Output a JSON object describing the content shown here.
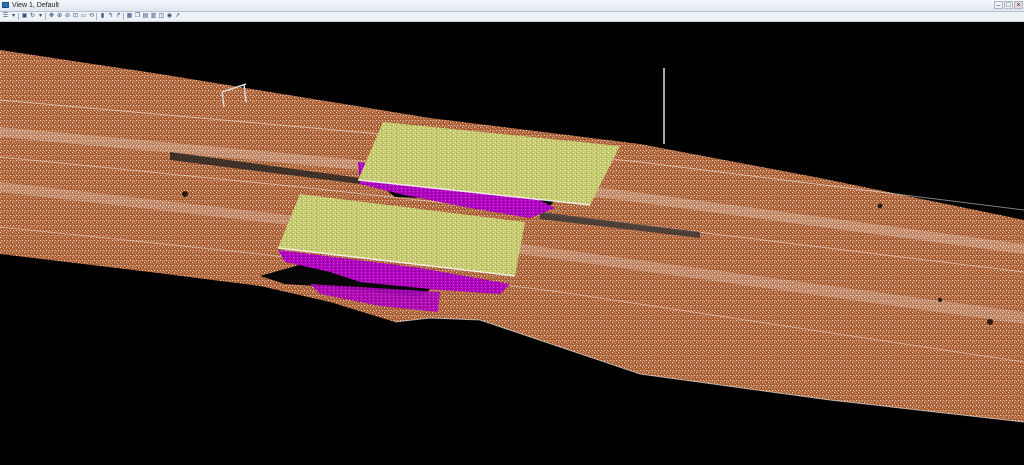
{
  "window": {
    "title": "View 1, Default",
    "controls": {
      "minimize": "–",
      "maximize": "□",
      "close": "×"
    }
  },
  "toolbar": {
    "buttons": [
      {
        "name": "view-attributes-icon",
        "glyph": "☰"
      },
      {
        "name": "dropdown-icon",
        "glyph": "▾"
      },
      {
        "name": "open-icon",
        "glyph": "▣"
      },
      {
        "name": "refresh-icon",
        "glyph": "↻"
      },
      {
        "name": "dropdown-icon",
        "glyph": "▾"
      },
      {
        "name": "pan-icon",
        "glyph": "✥"
      },
      {
        "name": "zoom-in-icon",
        "glyph": "⊕"
      },
      {
        "name": "zoom-out-icon",
        "glyph": "⊖"
      },
      {
        "name": "zoom-window-icon",
        "glyph": "⊡"
      },
      {
        "name": "fit-view-icon",
        "glyph": "▭"
      },
      {
        "name": "rotate-icon",
        "glyph": "⟲"
      },
      {
        "name": "select-icon",
        "glyph": "▮"
      },
      {
        "name": "undo-view-icon",
        "glyph": "↰"
      },
      {
        "name": "redo-view-icon",
        "glyph": "↱"
      },
      {
        "name": "window-area-icon",
        "glyph": "▦"
      },
      {
        "name": "copy-view-icon",
        "glyph": "❐"
      },
      {
        "name": "clip-volume-icon",
        "glyph": "▤"
      },
      {
        "name": "view-display-icon",
        "glyph": "▥"
      },
      {
        "name": "render-icon",
        "glyph": "◫"
      },
      {
        "name": "camera-icon",
        "glyph": "◉"
      },
      {
        "name": "view-toggle-icon",
        "glyph": "↗"
      }
    ]
  },
  "viewport": {
    "colors": {
      "background": "#000000",
      "ground": "#b0653a",
      "ground_light": "#d49a70",
      "points_white": "#ffffff",
      "deck": "#cfd27a",
      "under_structure": "#b000c0",
      "shadow": "#050505"
    }
  }
}
